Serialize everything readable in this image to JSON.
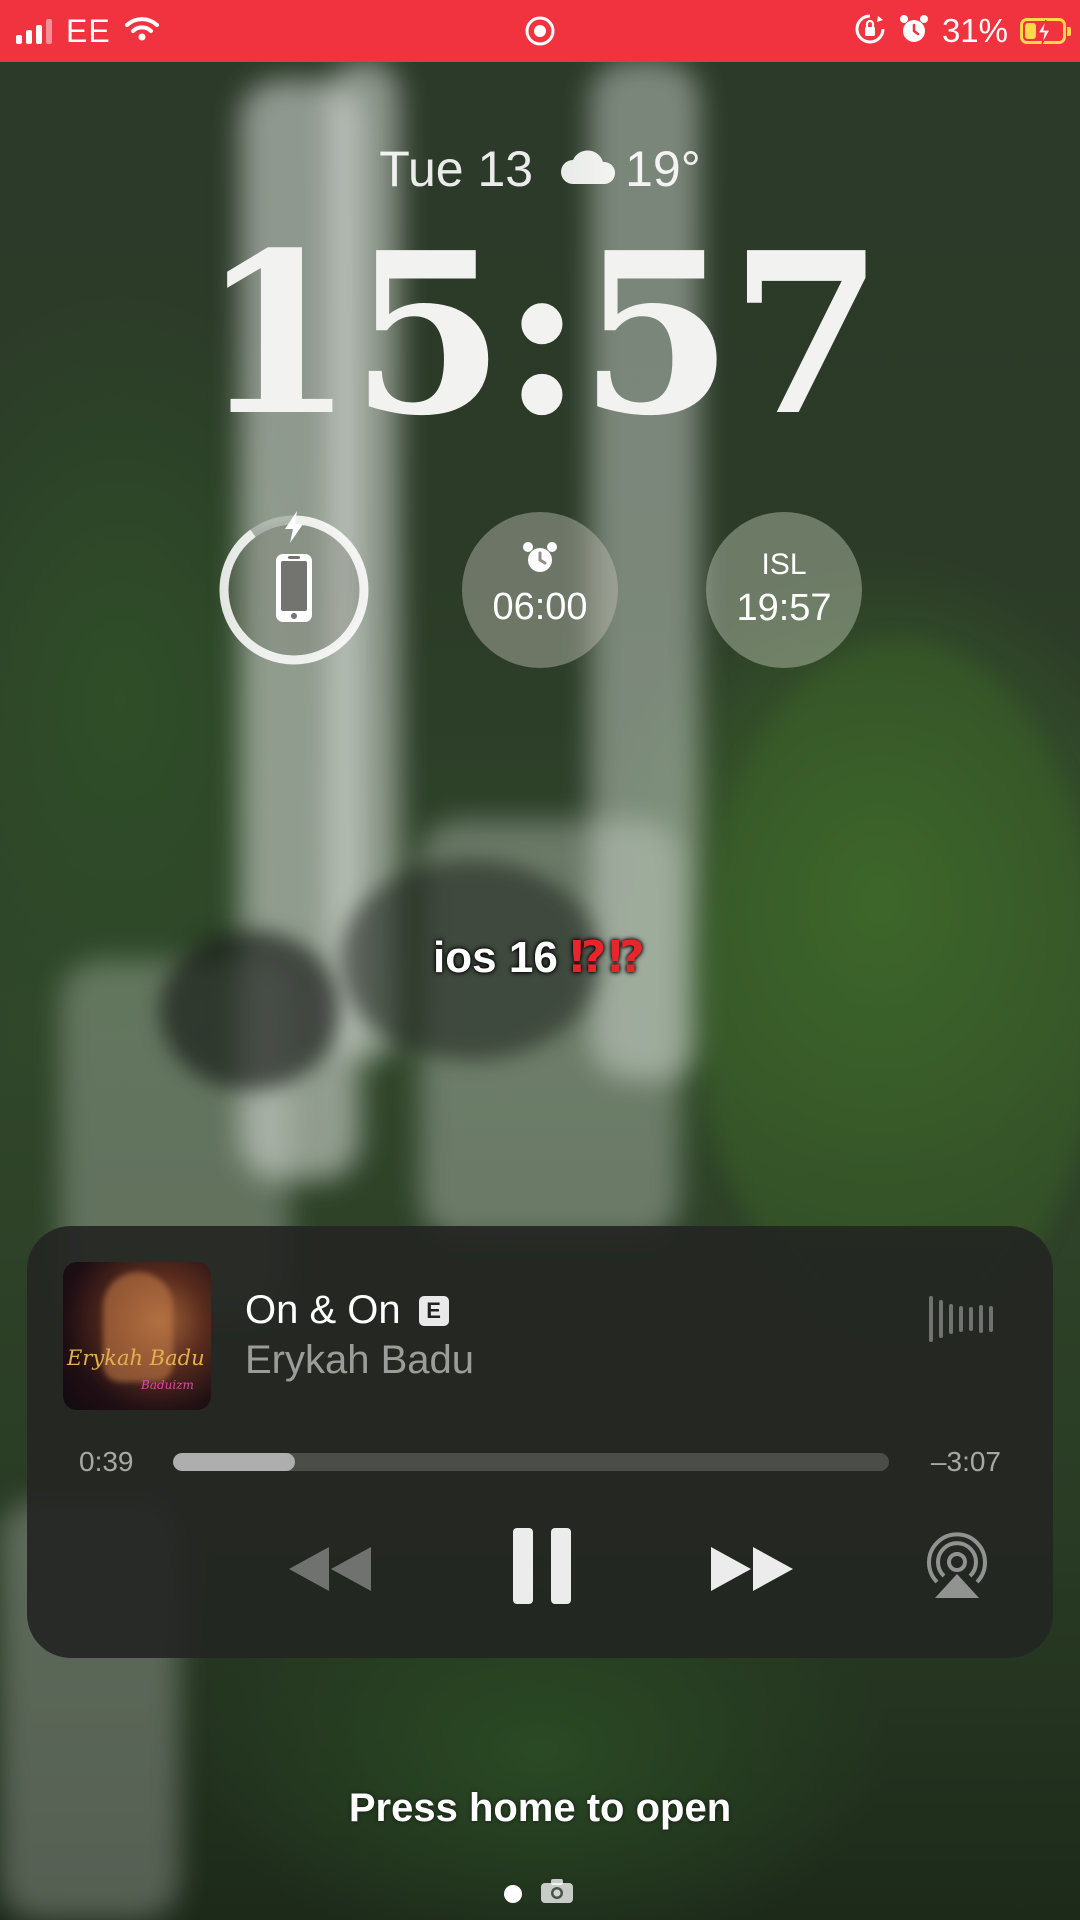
{
  "status_bar": {
    "carrier": "EE",
    "battery_percent": "31%",
    "battery_level": 0.31,
    "color": "#f0333e",
    "icons": [
      "signal-icon",
      "wifi-icon",
      "screen-record-icon",
      "rotation-lock-icon",
      "alarm-icon",
      "battery-charging-icon"
    ]
  },
  "lock_screen": {
    "date": "Tue 13",
    "weather_icon": "cloud-icon",
    "temperature": "19°",
    "time": "15:57"
  },
  "widgets": {
    "battery": {
      "icon": "iphone-icon",
      "charging": true,
      "level": 0.9
    },
    "alarm": {
      "icon": "alarm-clock-icon",
      "time": "06:00"
    },
    "world_clock": {
      "label": "ISL",
      "time": "19:57"
    }
  },
  "caption": {
    "text": "ios 16",
    "emoji": "⁉⁉"
  },
  "now_playing": {
    "album_art_text": "Erykah Badu",
    "album_art_subtext": "Baduizm",
    "title": "On & On",
    "explicit_badge": "E",
    "artist": "Erykah Badu",
    "elapsed": "0:39",
    "remaining": "–3:07",
    "progress": 0.17,
    "controls": [
      "rewind-icon",
      "pause-icon",
      "fast-forward-icon",
      "airplay-icon"
    ]
  },
  "footer": {
    "hint": "Press home to open",
    "pager_icons": [
      "page-dot-icon",
      "camera-icon"
    ]
  }
}
